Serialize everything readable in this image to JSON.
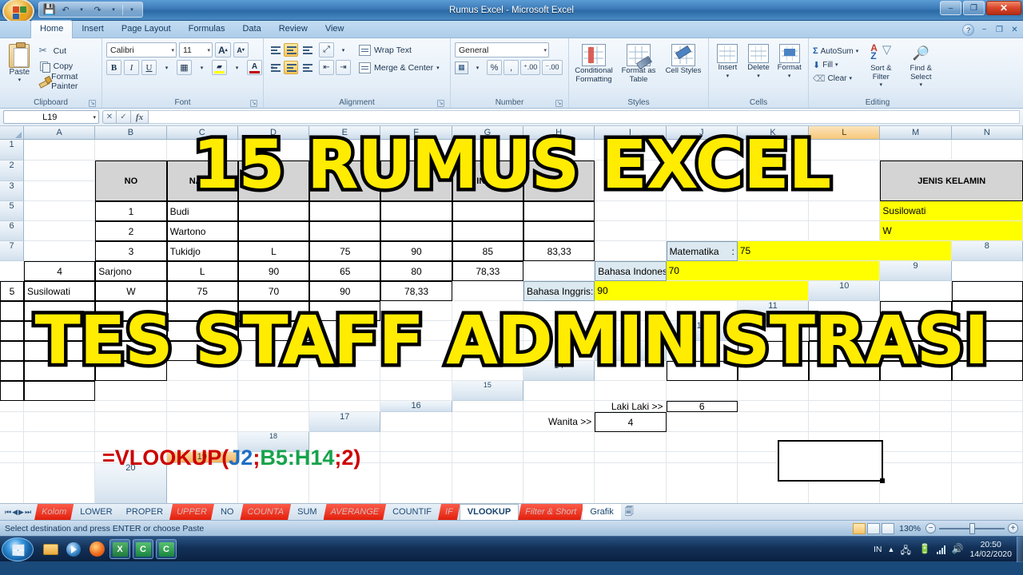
{
  "window": {
    "title": "Rumus Excel - Microsoft Excel",
    "minimize": "–",
    "maximize": "❐",
    "close": "✕"
  },
  "quick_access": {
    "save": "💾",
    "undo": "↶",
    "redo": "↷",
    "customize": "▾"
  },
  "ribbon": {
    "tabs": [
      "Home",
      "Insert",
      "Page Layout",
      "Formulas",
      "Data",
      "Review",
      "View"
    ],
    "active_tab": "Home",
    "help": "?",
    "groups": {
      "clipboard": {
        "label": "Clipboard",
        "paste": "Paste",
        "cut": "Cut",
        "copy": "Copy",
        "format_painter": "Format Painter"
      },
      "font": {
        "label": "Font",
        "font_name": "Calibri",
        "font_size": "11",
        "grow": "A",
        "shrink": "A",
        "bold": "B",
        "italic": "I",
        "underline": "U",
        "borders": "▦",
        "fill_color": "◢",
        "font_color": "A"
      },
      "alignment": {
        "label": "Alignment",
        "wrap_text": "Wrap Text",
        "merge_center": "Merge & Center"
      },
      "number": {
        "label": "Number",
        "format": "General",
        "percent": "%",
        "comma": ",",
        "increase_decimal": "·₀₀",
        "decrease_decimal": "·₀₀"
      },
      "styles": {
        "label": "Styles",
        "conditional_formatting": "Conditional Formatting",
        "format_as_table": "Format as Table",
        "cell_styles": "Cell Styles"
      },
      "cells": {
        "label": "Cells",
        "insert": "Insert",
        "delete": "Delete",
        "format": "Format"
      },
      "editing": {
        "label": "Editing",
        "autosum": "AutoSum",
        "fill": "Fill",
        "clear": "Clear",
        "sort_filter": "Sort & Filter",
        "find_select": "Find & Select"
      }
    }
  },
  "formula_bar": {
    "name_box": "L19",
    "cancel": "✕",
    "enter": "✓",
    "insert_function": "fx",
    "formula": ""
  },
  "sheet": {
    "column_headers": [
      "A",
      "B",
      "C",
      "D",
      "E",
      "F",
      "G",
      "H",
      "I",
      "J",
      "K",
      "L",
      "M",
      "N"
    ],
    "selected_column": "L",
    "row_headers": [
      "1",
      "2",
      "3",
      "5",
      "6",
      "7",
      "8",
      "9",
      "10",
      "11",
      "12",
      "13",
      "14",
      "15",
      "16",
      "17",
      "18",
      "19",
      "20"
    ],
    "selected_row": "19",
    "table_headers": {
      "no": "NO",
      "nama": "NAMA",
      "jenis_kelamin": "JENIS KELAMIN",
      "inggris": "INGG"
    },
    "rows": [
      {
        "row": "5",
        "no": "1",
        "nama": "Budi",
        "jk": "",
        "mat": "",
        "ind": "",
        "ing": "",
        "rata": ""
      },
      {
        "row": "6",
        "no": "2",
        "nama": "Wartono",
        "jk": "",
        "mat": "",
        "ind": "",
        "ing": "",
        "rata": ""
      },
      {
        "row": "7",
        "no": "3",
        "nama": "Tukidjo",
        "jk": "L",
        "mat": "75",
        "ind": "90",
        "ing": "85",
        "rata": "83,33"
      },
      {
        "row": "8",
        "no": "4",
        "nama": "Sarjono",
        "jk": "L",
        "mat": "90",
        "ind": "65",
        "ing": "80",
        "rata": "78,33"
      },
      {
        "row": "9",
        "no": "5",
        "nama": "Susilowati",
        "jk": "W",
        "mat": "75",
        "ind": "70",
        "ing": "90",
        "rata": "78,33"
      }
    ],
    "lookup_panel": {
      "title": "JENIS KELAMIN",
      "name_value": "Susilowati",
      "gender_value": "W",
      "fields": [
        {
          "label": "Matematika",
          "sep": ":",
          "value": "75"
        },
        {
          "label": "Bahasa Indonesia",
          "sep": ":",
          "value": "70"
        },
        {
          "label": "Bahasa Inggris",
          "sep": ":",
          "value": "90"
        }
      ]
    },
    "counts": [
      {
        "label": "Laki Laki >>",
        "value": "6"
      },
      {
        "label": "Wanita >>",
        "value": "4"
      }
    ]
  },
  "overlay": {
    "line1": "15 RUMUS EXCEL",
    "line2": "TES STAFF ADMINISTRASI",
    "formula_parts": {
      "p1": "=VLOOKUP(",
      "p2": "J2",
      "p3": ";",
      "p4": "B5:H14",
      "p5": ";2)"
    },
    "colors": {
      "fill": "#ffec00",
      "stroke": "#000000",
      "red": "#cc0000",
      "blue": "#1f6fc4",
      "green": "#16a34a"
    }
  },
  "sheet_tabs": {
    "nav": {
      "first": "⏮",
      "prev": "◀",
      "next": "▶",
      "last": "⏭"
    },
    "tabs": [
      {
        "label": "Kolom",
        "style": "red"
      },
      {
        "label": "LOWER",
        "style": "plain"
      },
      {
        "label": "PROPER",
        "style": "plain"
      },
      {
        "label": "UPPER",
        "style": "red"
      },
      {
        "label": "NO",
        "style": "plain"
      },
      {
        "label": "COUNTA",
        "style": "red"
      },
      {
        "label": "SUM",
        "style": "plain"
      },
      {
        "label": "AVERANGE",
        "style": "red"
      },
      {
        "label": "COUNTIF",
        "style": "plain"
      },
      {
        "label": "IF",
        "style": "red"
      },
      {
        "label": "VLOOKUP",
        "style": "active"
      },
      {
        "label": "Filter & Short",
        "style": "red"
      },
      {
        "label": "Grafik",
        "style": "white"
      }
    ],
    "insert_sheet": "➕"
  },
  "status_bar": {
    "message": "Select destination and press ENTER or choose Paste",
    "zoom": "130%",
    "zoom_out": "−",
    "zoom_in": "+",
    "views": [
      "normal-view",
      "page-layout-view",
      "page-break-view"
    ]
  },
  "taskbar": {
    "start": "start-orb",
    "items": [
      "folder-explorer",
      "media-player",
      "firefox",
      "excel-window-1",
      "excel-window-2",
      "excel-window-3"
    ],
    "tray": {
      "language": "IN",
      "time": "20:50",
      "date": "14/02/2020"
    }
  }
}
